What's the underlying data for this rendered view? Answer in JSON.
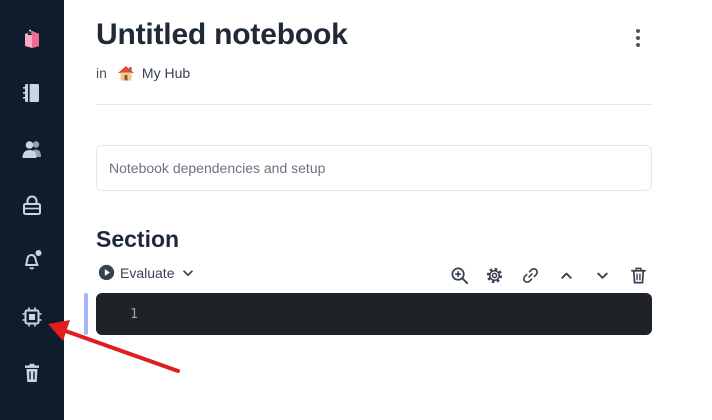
{
  "sidebar": {
    "items": [
      {
        "icon": "logo-icon"
      },
      {
        "icon": "notebook-icon"
      },
      {
        "icon": "users-icon"
      },
      {
        "icon": "lock-icon"
      },
      {
        "icon": "notifications-icon"
      },
      {
        "icon": "cpu-icon"
      },
      {
        "icon": "trash-icon"
      }
    ],
    "background": "#0f1c2e"
  },
  "notebook": {
    "title": "Untitled notebook",
    "location_prefix": "in",
    "hub_name": "My Hub",
    "setup_placeholder": "Notebook dependencies and setup"
  },
  "section": {
    "title": "Section",
    "evaluate_label": "Evaluate",
    "toolbar_icons": [
      "zoom-in-icon",
      "settings-icon",
      "link-icon",
      "chevron-up-icon",
      "chevron-down-icon",
      "trash-icon"
    ]
  },
  "editor": {
    "line_number": "1",
    "background": "#1f2227"
  },
  "annotation": {
    "arrow_color": "#e11d1d"
  }
}
